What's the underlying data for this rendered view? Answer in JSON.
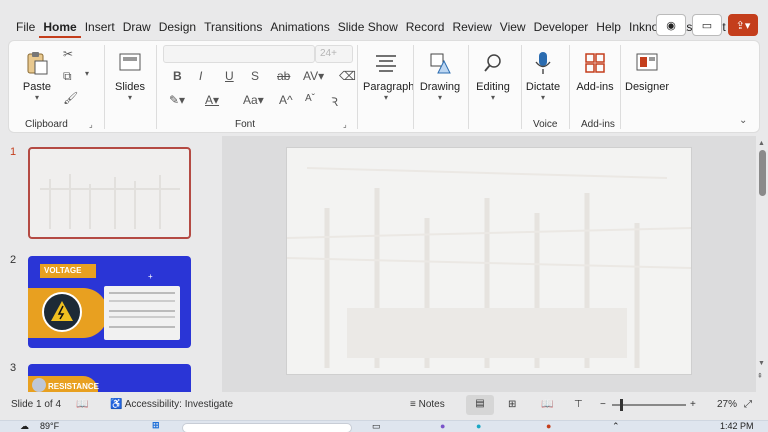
{
  "ribbon_tabs": [
    "File",
    "Home",
    "Insert",
    "Draw",
    "Design",
    "Transitions",
    "Animations",
    "Slide Show",
    "Record",
    "Review",
    "View",
    "Developer",
    "Help",
    "Inknoe ClassPoint"
  ],
  "active_tab": "Home",
  "clipboard": {
    "paste_label": "Paste",
    "group_label": "Clipboard"
  },
  "slides_group": {
    "label": "Slides"
  },
  "font_group": {
    "font_size": "24+",
    "group_label": "Font",
    "aa_label": "Aa",
    "a_big": "A",
    "a_small": "A"
  },
  "paragraph": {
    "label": "Paragraph"
  },
  "drawing": {
    "label": "Drawing"
  },
  "editing": {
    "label": "Editing"
  },
  "voice": {
    "dictate_label": "Dictate",
    "group_label": "Voice"
  },
  "addins": {
    "label": "Add-ins",
    "group_label": "Add-ins"
  },
  "designer": {
    "label": "Designer"
  },
  "slides": [
    {
      "number": "1"
    },
    {
      "number": "2",
      "title": "VOLTAGE"
    },
    {
      "number": "3",
      "title": "RESISTANCE"
    }
  ],
  "status": {
    "slide_counter": "Slide 1 of 4",
    "accessibility": "Accessibility: Investigate",
    "notes_label": "Notes",
    "zoom": "27%"
  },
  "taskbar": {
    "weather": "89°F",
    "clock": "1:42 PM"
  },
  "colors": {
    "accent": "#c43e1c",
    "slide2_bg": "#2a35d6",
    "slide2_gold": "#e8a020"
  }
}
